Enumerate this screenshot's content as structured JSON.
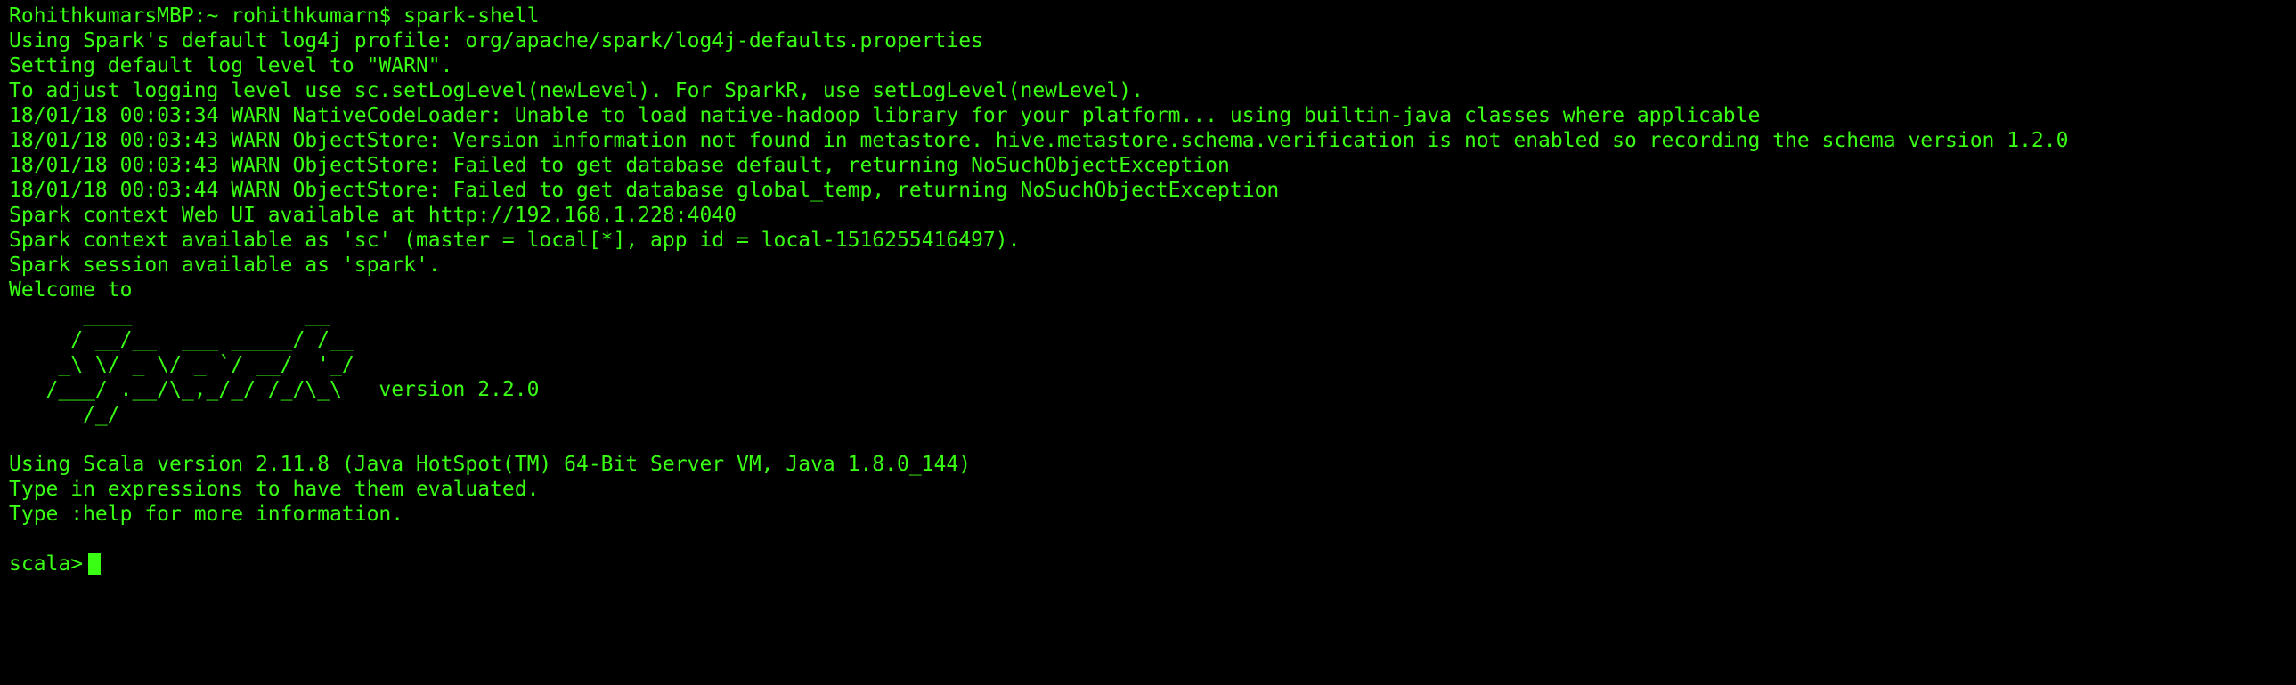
{
  "colors": {
    "background": "#000000",
    "text": "#39ff14"
  },
  "terminal": {
    "lines": [
      "RohithkumarsMBP:~ rohithkumarn$ spark-shell",
      "Using Spark's default log4j profile: org/apache/spark/log4j-defaults.properties",
      "Setting default log level to \"WARN\".",
      "To adjust logging level use sc.setLogLevel(newLevel). For SparkR, use setLogLevel(newLevel).",
      "18/01/18 00:03:34 WARN NativeCodeLoader: Unable to load native-hadoop library for your platform... using builtin-java classes where applicable",
      "18/01/18 00:03:43 WARN ObjectStore: Version information not found in metastore. hive.metastore.schema.verification is not enabled so recording the schema version 1.2.0",
      "18/01/18 00:03:43 WARN ObjectStore: Failed to get database default, returning NoSuchObjectException",
      "18/01/18 00:03:44 WARN ObjectStore: Failed to get database global_temp, returning NoSuchObjectException",
      "Spark context Web UI available at http://192.168.1.228:4040",
      "Spark context available as 'sc' (master = local[*], app id = local-1516255416497).",
      "Spark session available as 'spark'.",
      "Welcome to",
      "      ____              __",
      "     / __/__  ___ _____/ /__",
      "    _\\ \\/ _ \\/ _ `/ __/  '_/",
      "   /___/ .__/\\_,_/_/ /_/\\_\\   version 2.2.0",
      "      /_/",
      "",
      "Using Scala version 2.11.8 (Java HotSpot(TM) 64-Bit Server VM, Java 1.8.0_144)",
      "Type in expressions to have them evaluated.",
      "Type :help for more information.",
      ""
    ],
    "prompt": "scala>"
  }
}
